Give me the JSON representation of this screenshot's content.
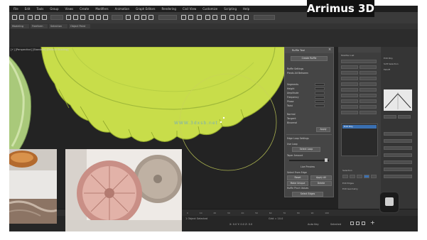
{
  "logo": {
    "text": "Arrimus 3D"
  },
  "menubar": {
    "items": [
      "File",
      "Edit",
      "Tools",
      "Group",
      "Views",
      "Create",
      "Modifiers",
      "Animation",
      "Graph Editors",
      "Rendering",
      "Civil View",
      "Customize",
      "Scripting",
      "Help"
    ]
  },
  "tabs": [
    "Modeling",
    "Freeform",
    "Selection",
    "Object Paint"
  ],
  "viewport": {
    "label": "[+] [Perspective] [Standard] [Default Shading]",
    "watermark": "WWW.3dxsb.net"
  },
  "dialog": {
    "title": "Ruffle Tool",
    "create_button": "Create Ruffle",
    "section_label": "Ruffle Settings",
    "pleat_label": "Pleats Alt Between",
    "options": [
      {
        "label": "Segments",
        "value": "16"
      },
      {
        "label": "Height",
        "value": "5.0"
      },
      {
        "label": "Amplitude",
        "value": "1.0"
      },
      {
        "label": "Frequency",
        "value": "1.0"
      },
      {
        "label": "Phase",
        "value": "0.0"
      },
      {
        "label": "Twist",
        "value": "0.0"
      }
    ],
    "radios": [
      "Normal",
      "Tangent",
      "Binormal"
    ],
    "apply_button": "Apply",
    "group_label": "Edge Loop Settings",
    "loop_label": "Use Loop",
    "loop_button": "Select Loop",
    "slider_label": "Taper Amount",
    "preview_label": "Live Preview",
    "bottom_label": "Select From Edge",
    "btn_a": "Reset",
    "btn_b": "Apply All",
    "btn_c": "Make Unique",
    "btn_d": "Delete",
    "footer_label": "Ruffle Pinch Values",
    "footer_button": "Select Edges"
  },
  "right_panel": {
    "header": "Modifier List",
    "edit_label": "Edit Poly",
    "stack_item": "Edit Poly",
    "sub_label": "Soft Selection",
    "soft_label": "Falloff",
    "groups": [
      "Selection",
      "Edit Edges",
      "Edit Geometry"
    ]
  },
  "timeline": {
    "frames": [
      "0",
      "10",
      "20",
      "30",
      "40",
      "50",
      "60",
      "70",
      "80",
      "90",
      "100"
    ]
  },
  "statusbar": {
    "left": "1 Object Selected",
    "coords": "X: 0.0  Y: 0.0  Z: 0.0",
    "grid": "Grid = 10.0",
    "auto_key": "Auto Key",
    "selected": "Selected"
  },
  "colors": {
    "accent": "#c8dd4a",
    "app_bg": "#2b2b2b",
    "panel_bg": "#454545",
    "select_blue": "#3a6fb0"
  }
}
